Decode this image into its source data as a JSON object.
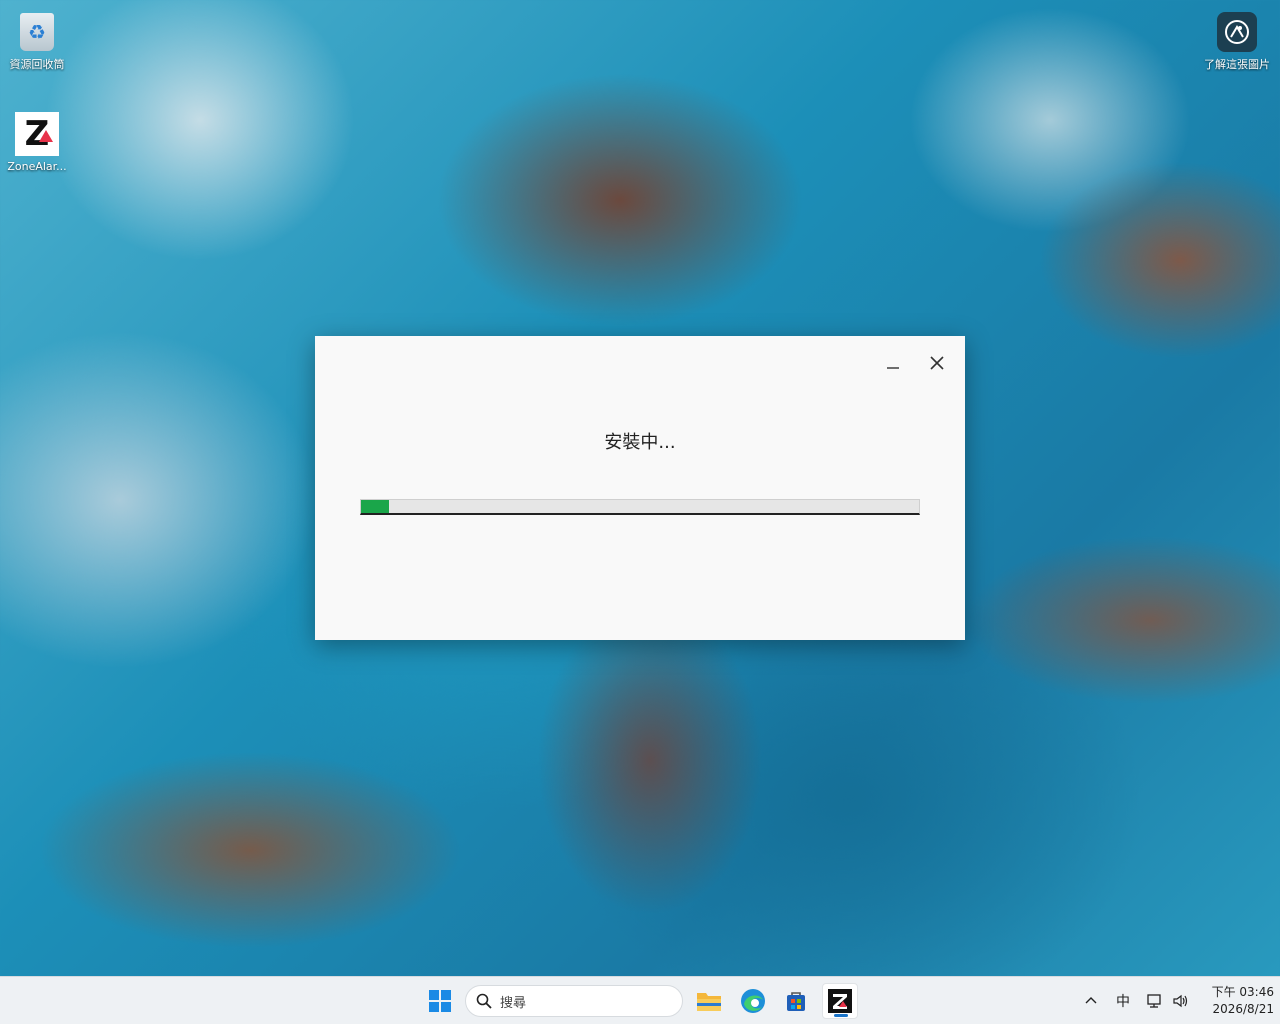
{
  "desktop": {
    "icons": [
      {
        "label": "資源回收筒"
      },
      {
        "label": "ZoneAlar..."
      },
      {
        "label": "了解這張圖片"
      }
    ]
  },
  "installer": {
    "status_text": "安裝中...",
    "progress_percent": 5
  },
  "taskbar": {
    "search_placeholder": "搜尋",
    "ime_indicator": "中",
    "clock_time": "下午 03:46",
    "clock_date": "2026/8/21"
  }
}
